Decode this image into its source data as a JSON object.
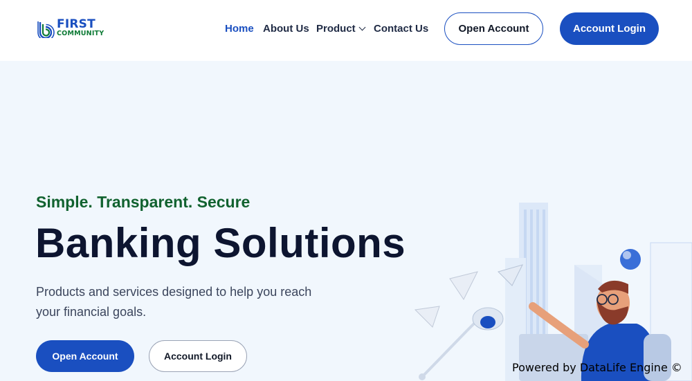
{
  "brand": {
    "logo_line1": "FIRST",
    "logo_line2": "COMMUNITY",
    "primary_color": "#1a4fc0",
    "secondary_color": "#0d7a35"
  },
  "nav": {
    "items": [
      {
        "label": "Home",
        "active": true
      },
      {
        "label": "About Us",
        "active": false
      },
      {
        "label": "Product",
        "active": false
      },
      {
        "label": "Contact Us",
        "active": false
      }
    ]
  },
  "header_actions": {
    "open_account": "Open Account",
    "account_login": "Account Login"
  },
  "hero": {
    "tagline": "Simple. Transparent. Secure",
    "headline": "Banking Solutions",
    "subtext": "Products and services designed to help you reach your financial goals.",
    "open_account": "Open Account",
    "account_login": "Account Login",
    "illustration": "man-at-laptop-with-lamp-illustration"
  },
  "footer": {
    "credit": "Powered by DataLife Engine ©"
  }
}
